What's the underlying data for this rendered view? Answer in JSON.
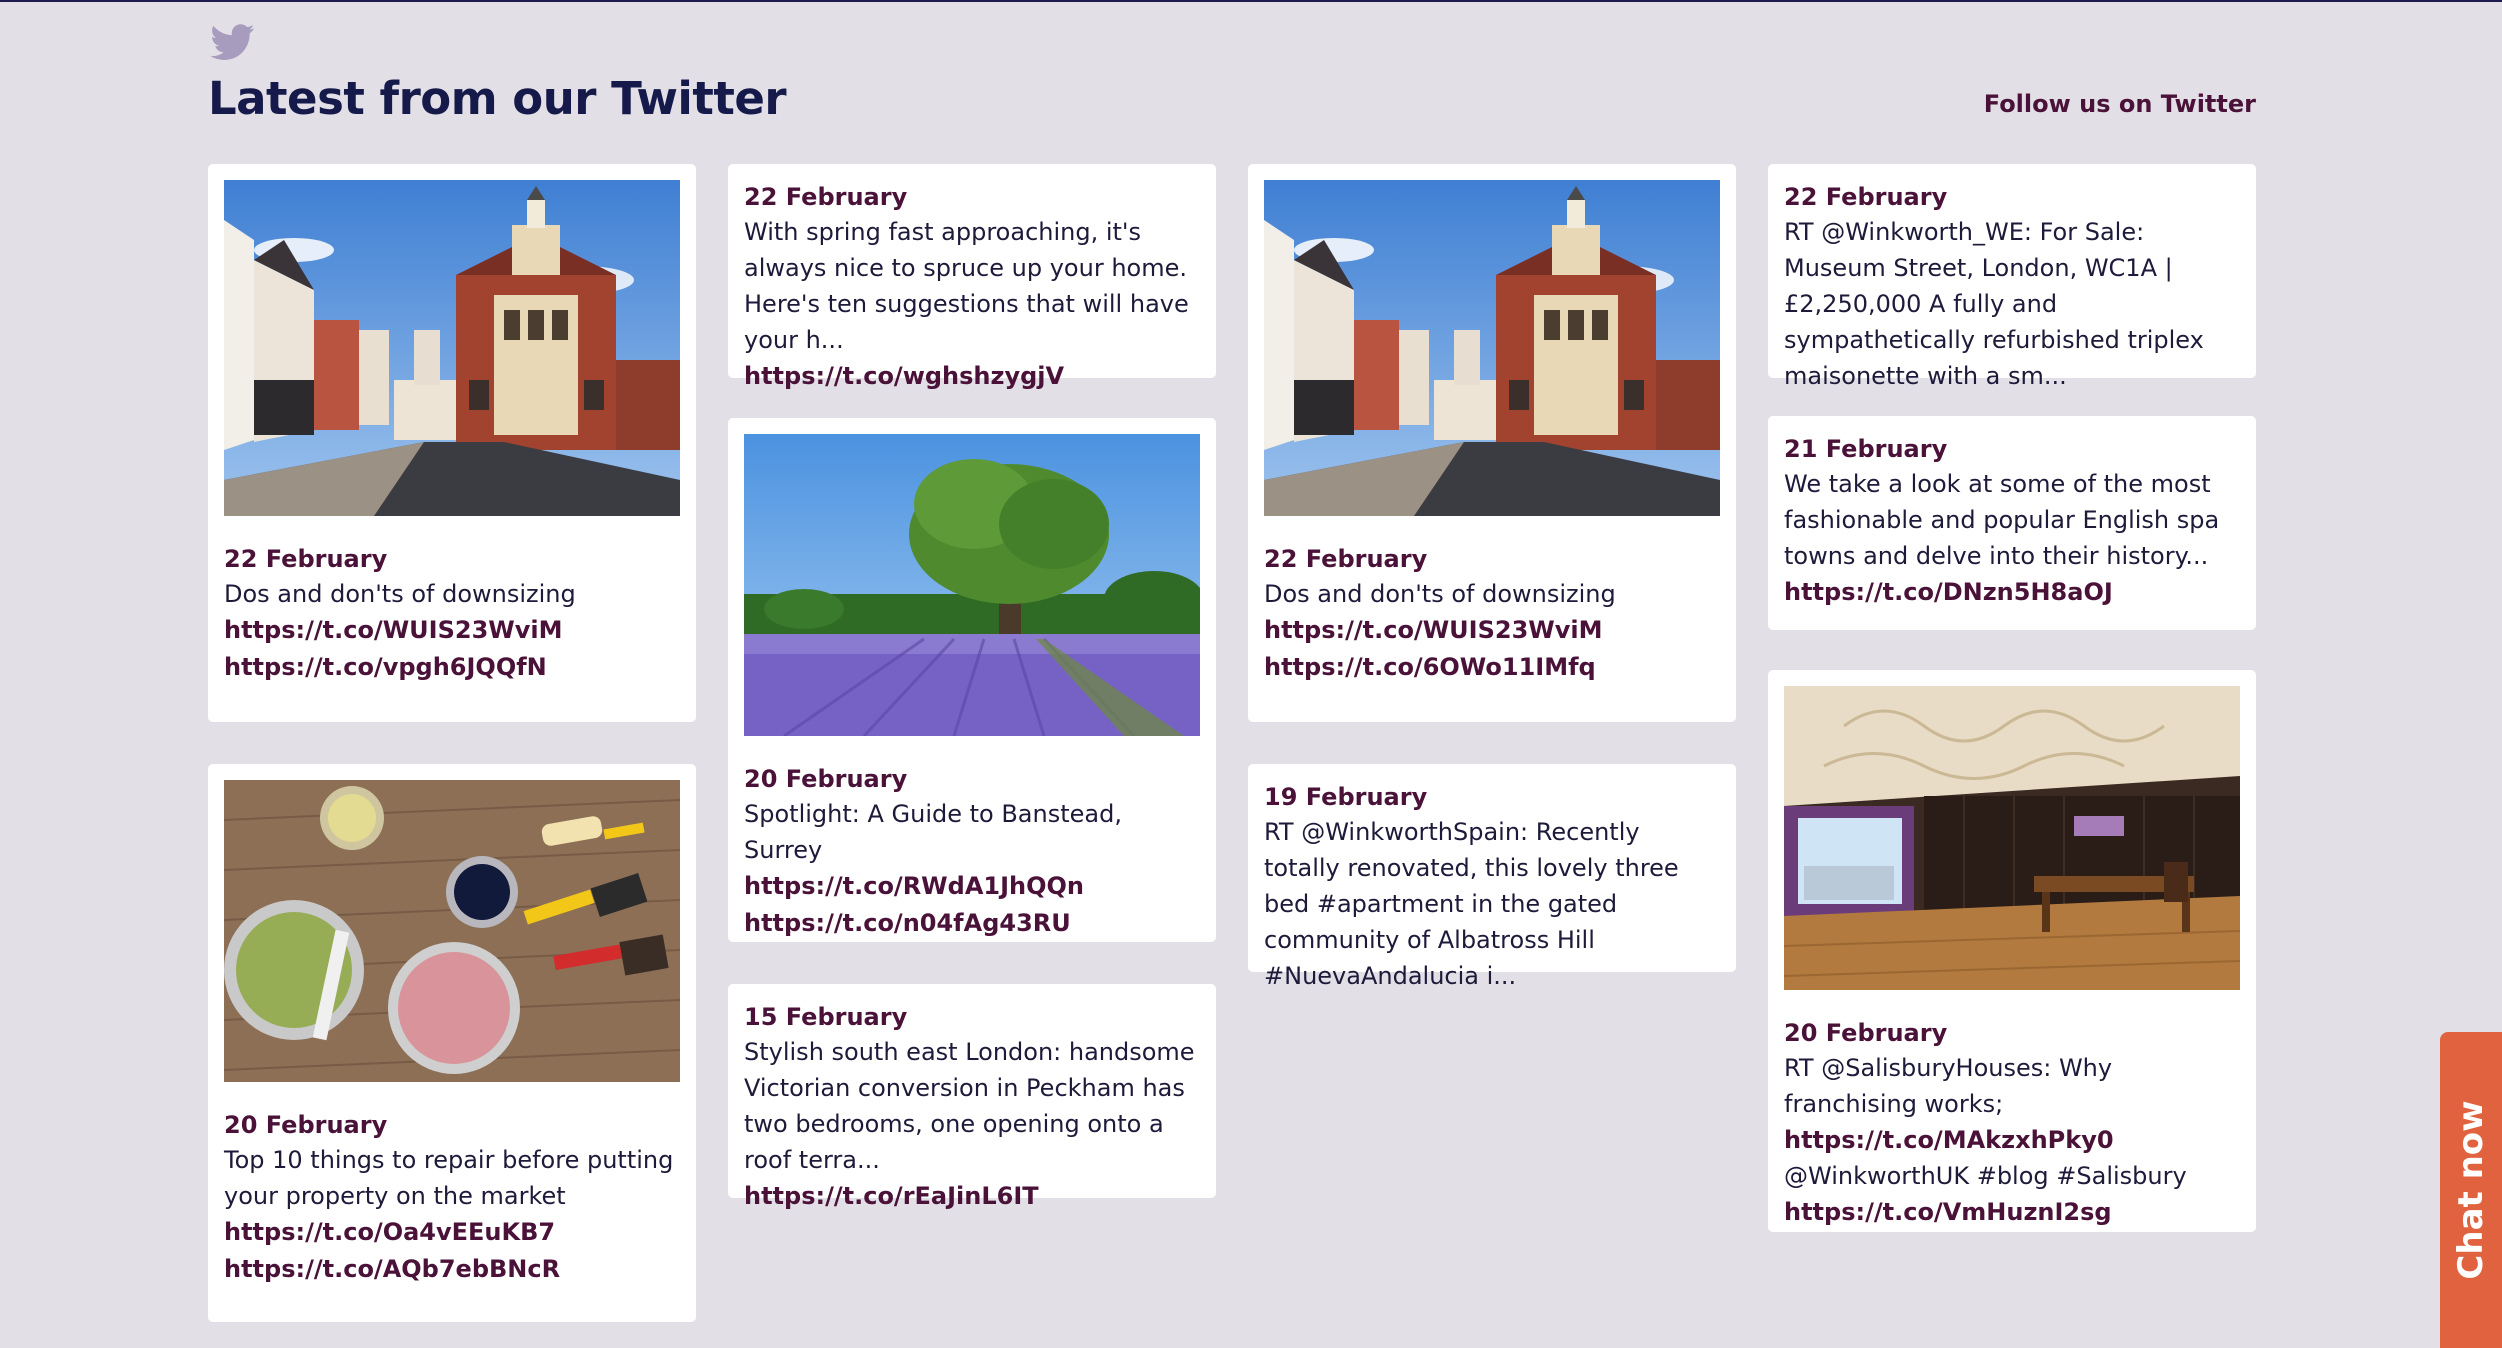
{
  "section": {
    "title": "Latest from our Twitter",
    "follow_label": "Follow us on Twitter"
  },
  "tweets": [
    {
      "date": "22 February",
      "text": "Dos and don'ts of downsizing",
      "links": [
        "https://t.co/WUIS23WviM",
        "https://t.co/vpgh6JQQfN"
      ],
      "image": "town-hall-street"
    },
    {
      "date": "20 February",
      "text": "Top 10 things to repair before putting your property on the market",
      "links": [
        "https://t.co/Oa4vEEuKB7",
        "https://t.co/AQb7ebBNcR"
      ],
      "image": "paint-tins"
    },
    {
      "date": "22 February",
      "text": "With spring fast approaching, it's always nice to spruce up your home. Here's ten suggestions that will have your h...",
      "links": [
        "https://t.co/wghshzygjV"
      ]
    },
    {
      "date": "20 February",
      "text": "Spotlight: A Guide to Banstead, Surrey",
      "links": [
        "https://t.co/RWdA1JhQQn",
        "https://t.co/n04fAg43RU"
      ],
      "image": "lavender-field-tree"
    },
    {
      "date": "15 February",
      "text": "Stylish south east London: handsome Victorian conversion in Peckham has two bedrooms, one opening onto a roof terra...",
      "links": [
        "https://t.co/rEaJinL6IT"
      ]
    },
    {
      "date": "22 February",
      "text": "Dos and don'ts of downsizing",
      "links": [
        "https://t.co/WUIS23WviM",
        "https://t.co/6OWo11IMfq"
      ],
      "image": "town-hall-street"
    },
    {
      "date": "19 February",
      "text": "RT @WinkworthSpain: Recently totally renovated, this lovely three bed #apartment in the gated community of Albatross Hill #NuevaAndalucia i..."
    },
    {
      "date": "22 February",
      "text": "RT @Winkworth_WE: For Sale: Museum Street, London, WC1A | £2,250,000 A fully and sympathetically refurbished triplex maisonette with a sm..."
    },
    {
      "date": "21 February",
      "text": "We take a look at some of the most fashionable and popular English spa towns and delve into their history...",
      "links": [
        "https://t.co/DNzn5H8aOJ"
      ]
    },
    {
      "date": "20 February",
      "text_before": "RT @SalisburyHouses: Why franchising works;",
      "inline_link": "https://t.co/MAkzxhPky0",
      "text_after": "@WinkworthUK #blog #Salisbury",
      "links": [
        "https://t.co/VmHuznI2sg"
      ],
      "image": "office-interior"
    }
  ],
  "chat": {
    "label": "Chat now"
  },
  "colors": {
    "background": "#e2e0e6",
    "accent": "#4a1238",
    "heading": "#151a4a",
    "chat": "#e0623f"
  },
  "icons": {
    "logo": "twitter-bird-icon"
  }
}
